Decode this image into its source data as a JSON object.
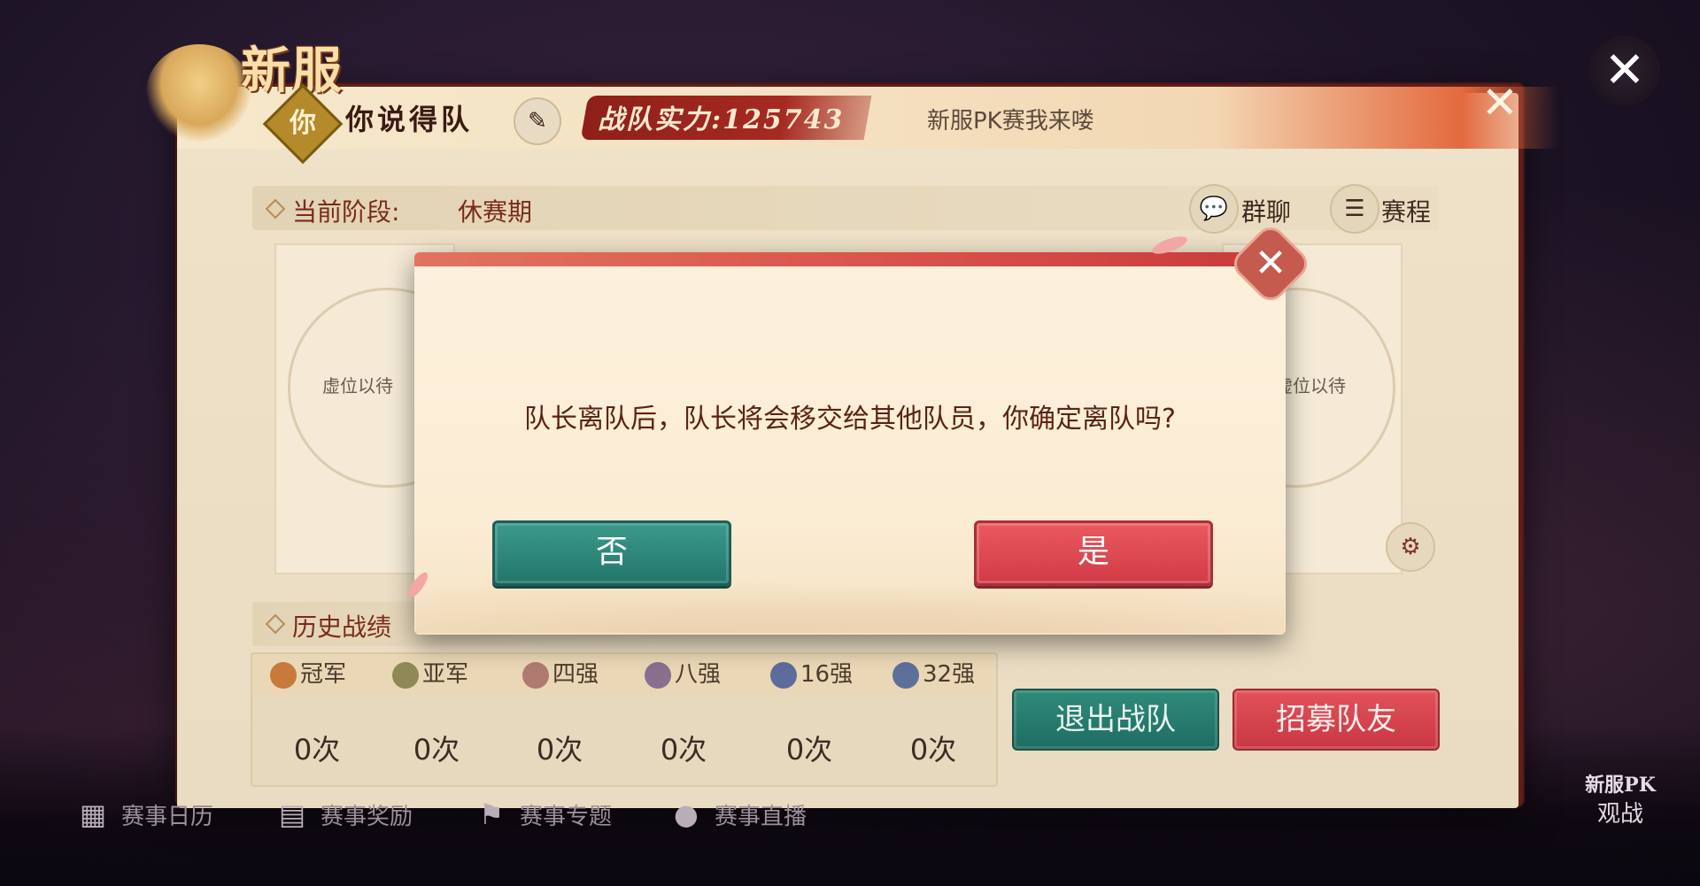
{
  "header": {
    "logo_text": "新服",
    "team_badge": "你",
    "team_name": "你说得队",
    "power_text": "战队实力:125743",
    "slogan": "新服PK赛我来喽"
  },
  "stage": {
    "label": "当前阶段:",
    "value": "休赛期",
    "chat_label": "群聊",
    "schedule_label": "赛程"
  },
  "slots": {
    "left_text": "虚位以待",
    "right_text": "虚位以待"
  },
  "history": {
    "label": "历史战绩",
    "ranks": [
      "冠军",
      "亚军",
      "四强",
      "八强",
      "16强",
      "32强"
    ],
    "counts": [
      "0次",
      "0次",
      "0次",
      "0次",
      "0次",
      "0次"
    ]
  },
  "actions": {
    "quit_label": "退出战队",
    "recruit_label": "招募队友"
  },
  "bottom_nav": {
    "items": [
      "赛事日历",
      "赛事奖励",
      "赛事专题",
      "赛事直播"
    ]
  },
  "spectate": {
    "logo": "新服PK",
    "label": "观战"
  },
  "modal": {
    "message": "队长离队后，队长将会移交给其他队员，你确定离队吗?",
    "no_label": "否",
    "yes_label": "是"
  },
  "colors": {
    "teal_button": "#23766b",
    "red_button": "#d13b46",
    "panel_bg": "#efe2c9",
    "dark_red_text": "#7a2b1a"
  },
  "icons": {
    "close": "close-icon",
    "edit": "brush-icon",
    "chat": "chat-bubble-icon",
    "schedule": "document-icon",
    "settings": "gear-icon",
    "calendar": "calendar-icon",
    "reward": "gift-icon",
    "topic": "flag-icon",
    "live": "camera-icon"
  }
}
